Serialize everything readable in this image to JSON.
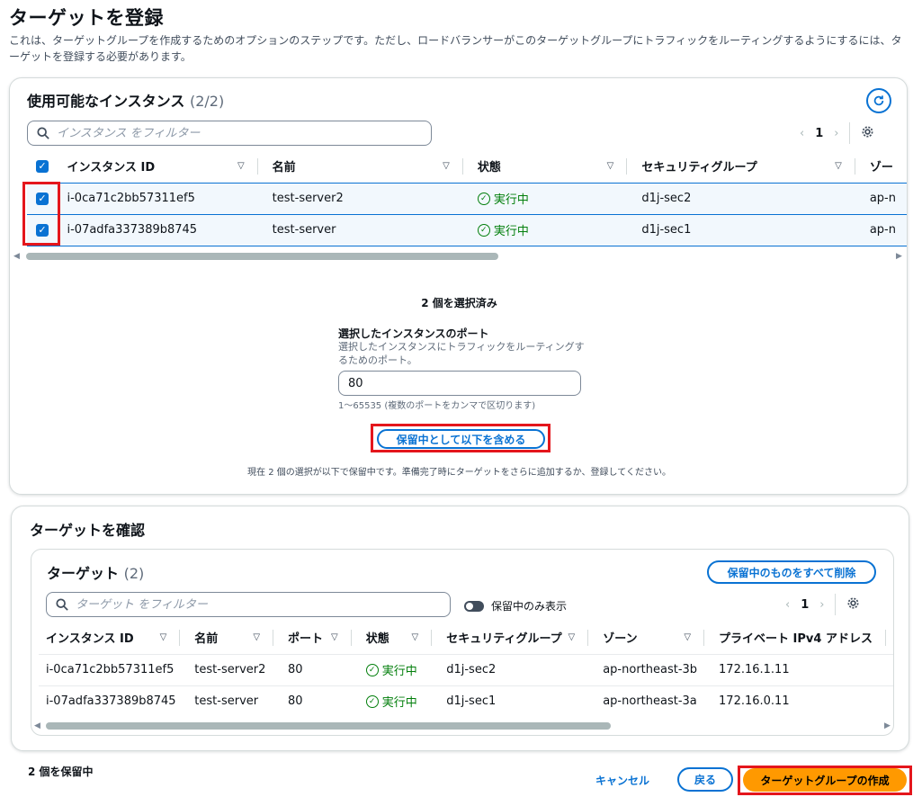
{
  "page": {
    "title": "ターゲットを登録",
    "description": "これは、ターゲットグループを作成するためのオプションのステップです。ただし、ロードバランサーがこのターゲットグループにトラフィックをルーティングするようにするには、ターゲットを登録する必要があります。"
  },
  "available": {
    "title": "使用可能なインスタンス",
    "count": "(2/2)",
    "filter_placeholder": "インスタンス をフィルター",
    "page_num": "1",
    "columns": [
      "インスタンス ID",
      "名前",
      "状態",
      "セキュリティグループ",
      "ゾー"
    ],
    "rows": [
      {
        "id": "i-0ca71c2bb57311ef5",
        "name": "test-server2",
        "state": "実行中",
        "sg": "d1j-sec2",
        "zone": "ap-n"
      },
      {
        "id": "i-07adfa337389b8745",
        "name": "test-server",
        "state": "実行中",
        "sg": "d1j-sec1",
        "zone": "ap-n"
      }
    ],
    "selected_label": "2 個を選択済み",
    "port_label": "選択したインスタンスのポート",
    "port_desc_1": "選択したインスタンスにトラフィックをルーティングす",
    "port_desc_2": "るためのポート。",
    "port_value": "80",
    "port_hint": "1〜65535 (複数のポートをカンマで区切ります)",
    "include_button": "保留中として以下を含める",
    "pending_note": "現在 2 個の選択が以下で保留中です。準備完了時にターゲットをさらに追加するか、登録してください。"
  },
  "review": {
    "title": "ターゲットを確認",
    "targets_title": "ターゲット",
    "targets_count": "(2)",
    "remove_all_button": "保留中のものをすべて削除",
    "filter_placeholder": "ターゲット をフィルター",
    "toggle_label": "保留中のみ表示",
    "page_num": "1",
    "columns": [
      "インスタンス ID",
      "名前",
      "ポート",
      "状態",
      "セキュリティグループ",
      "ゾーン",
      "プライベート IPv4 アドレス"
    ],
    "rows": [
      {
        "id": "i-0ca71c2bb57311ef5",
        "name": "test-server2",
        "port": "80",
        "state": "実行中",
        "sg": "d1j-sec2",
        "zone": "ap-northeast-3b",
        "ip": "172.16.1.11"
      },
      {
        "id": "i-07adfa337389b8745",
        "name": "test-server",
        "port": "80",
        "state": "実行中",
        "sg": "d1j-sec1",
        "zone": "ap-northeast-3a",
        "ip": "172.16.0.11"
      }
    ]
  },
  "footer": {
    "pending_count": "2 個を保留中",
    "cancel": "キャンセル",
    "back": "戻る",
    "create": "ターゲットグループの作成"
  },
  "colors": {
    "accent": "#0972d3",
    "primary_button": "#ff9900",
    "success": "#037f0c",
    "highlight": "#e4161c"
  }
}
